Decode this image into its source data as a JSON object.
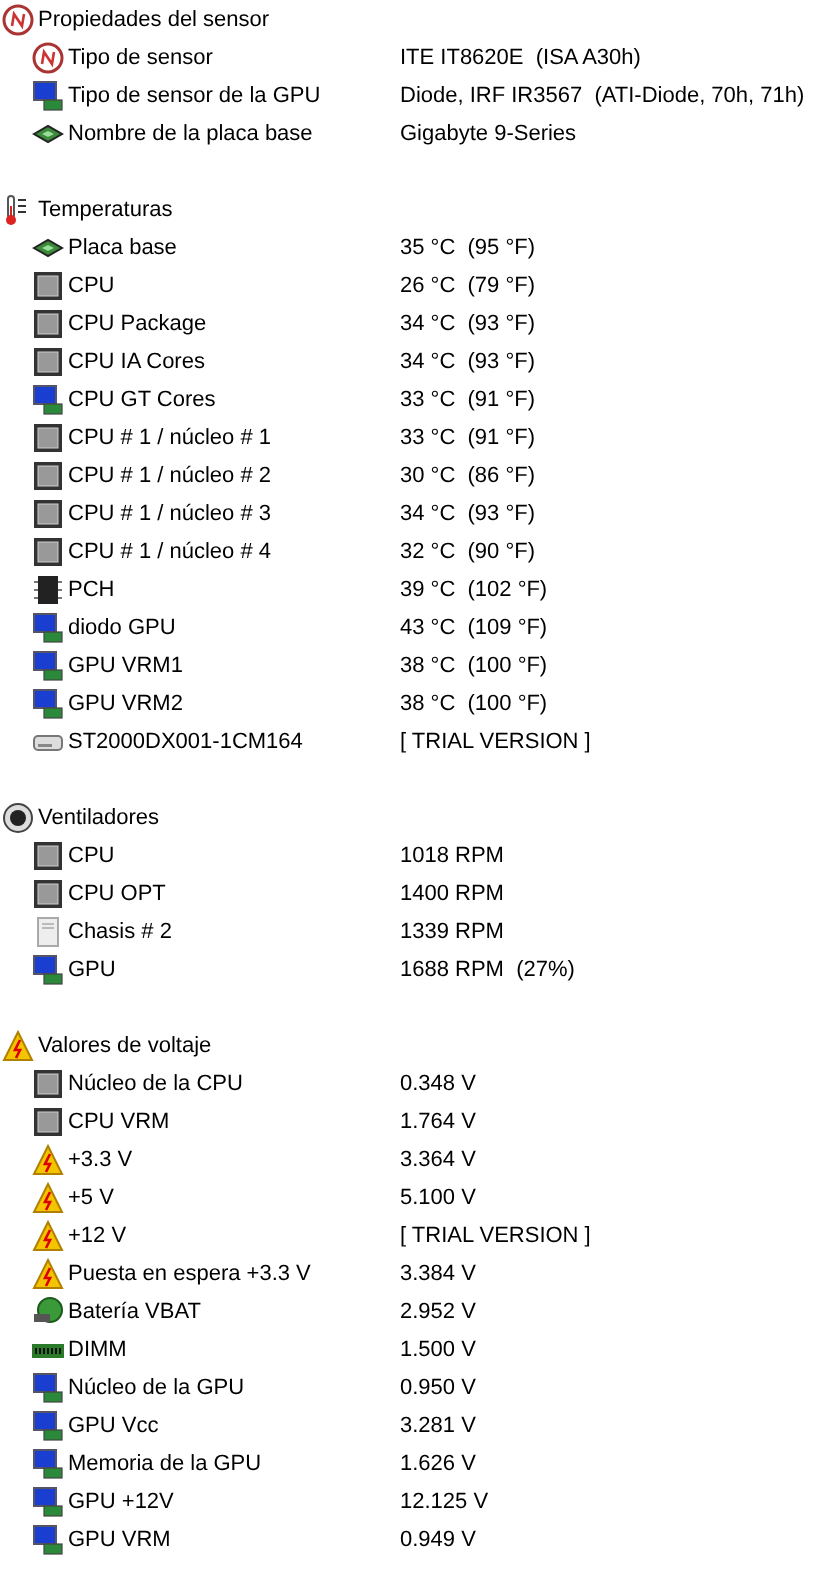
{
  "sections": [
    {
      "title": "Propiedades del sensor",
      "kind": "sensor",
      "items": [
        {
          "label": "Tipo de sensor",
          "kind": "sensor",
          "value": "ITE IT8620E  (ISA A30h)"
        },
        {
          "label": "Tipo de sensor de la GPU",
          "kind": "gpu",
          "value": "Diode, IRF IR3567  (ATI-Diode, 70h, 71h)"
        },
        {
          "label": "Nombre de la placa base",
          "kind": "board",
          "value": "Gigabyte 9-Series"
        }
      ]
    },
    {
      "title": "Temperaturas",
      "kind": "thermo",
      "items": [
        {
          "label": "Placa base",
          "kind": "board",
          "value": "35 °C  (95 °F)"
        },
        {
          "label": "CPU",
          "kind": "cpu",
          "value": "26 °C  (79 °F)"
        },
        {
          "label": "CPU Package",
          "kind": "cpu",
          "value": "34 °C  (93 °F)"
        },
        {
          "label": "CPU IA Cores",
          "kind": "cpu",
          "value": "34 °C  (93 °F)"
        },
        {
          "label": "CPU GT Cores",
          "kind": "gpu",
          "value": "33 °C  (91 °F)"
        },
        {
          "label": "CPU # 1 / núcleo # 1",
          "kind": "cpu",
          "value": "33 °C  (91 °F)"
        },
        {
          "label": "CPU # 1 / núcleo # 2",
          "kind": "cpu",
          "value": "30 °C  (86 °F)"
        },
        {
          "label": "CPU # 1 / núcleo # 3",
          "kind": "cpu",
          "value": "34 °C  (93 °F)"
        },
        {
          "label": "CPU # 1 / núcleo # 4",
          "kind": "cpu",
          "value": "32 °C  (90 °F)"
        },
        {
          "label": "PCH",
          "kind": "chip",
          "value": "39 °C  (102 °F)"
        },
        {
          "label": "diodo GPU",
          "kind": "gpu",
          "value": "43 °C  (109 °F)"
        },
        {
          "label": "GPU VRM1",
          "kind": "gpu",
          "value": "38 °C  (100 °F)"
        },
        {
          "label": "GPU VRM2",
          "kind": "gpu",
          "value": "38 °C  (100 °F)"
        },
        {
          "label": "ST2000DX001-1CM164",
          "kind": "hdd",
          "value": "[ TRIAL VERSION ]"
        }
      ]
    },
    {
      "title": "Ventiladores",
      "kind": "fan",
      "items": [
        {
          "label": "CPU",
          "kind": "cpu",
          "value": "1018 RPM"
        },
        {
          "label": "CPU OPT",
          "kind": "cpu",
          "value": "1400 RPM"
        },
        {
          "label": "Chasis # 2",
          "kind": "case",
          "value": "1339 RPM"
        },
        {
          "label": "GPU",
          "kind": "gpu",
          "value": "1688 RPM  (27%)"
        }
      ]
    },
    {
      "title": "Valores de voltaje",
      "kind": "warning",
      "items": [
        {
          "label": "Núcleo de la CPU",
          "kind": "cpu",
          "value": "0.348 V"
        },
        {
          "label": "CPU VRM",
          "kind": "cpu",
          "value": "1.764 V"
        },
        {
          "label": "+3.3 V",
          "kind": "warning",
          "value": "3.364 V"
        },
        {
          "label": "+5 V",
          "kind": "warning",
          "value": "5.100 V"
        },
        {
          "label": "+12 V",
          "kind": "warning",
          "value": "[ TRIAL VERSION ]"
        },
        {
          "label": "Puesta en espera +3.3 V",
          "kind": "warning",
          "value": "3.384 V"
        },
        {
          "label": "Batería VBAT",
          "kind": "battery",
          "value": "2.952 V"
        },
        {
          "label": "DIMM",
          "kind": "dimm",
          "value": "1.500 V"
        },
        {
          "label": "Núcleo de la GPU",
          "kind": "gpu",
          "value": "0.950 V"
        },
        {
          "label": "GPU Vcc",
          "kind": "gpu",
          "value": "3.281 V"
        },
        {
          "label": "Memoria de la GPU",
          "kind": "gpu",
          "value": "1.626 V"
        },
        {
          "label": "GPU +12V",
          "kind": "gpu",
          "value": "12.125 V"
        },
        {
          "label": "GPU VRM",
          "kind": "gpu",
          "value": "0.949 V"
        }
      ]
    }
  ]
}
